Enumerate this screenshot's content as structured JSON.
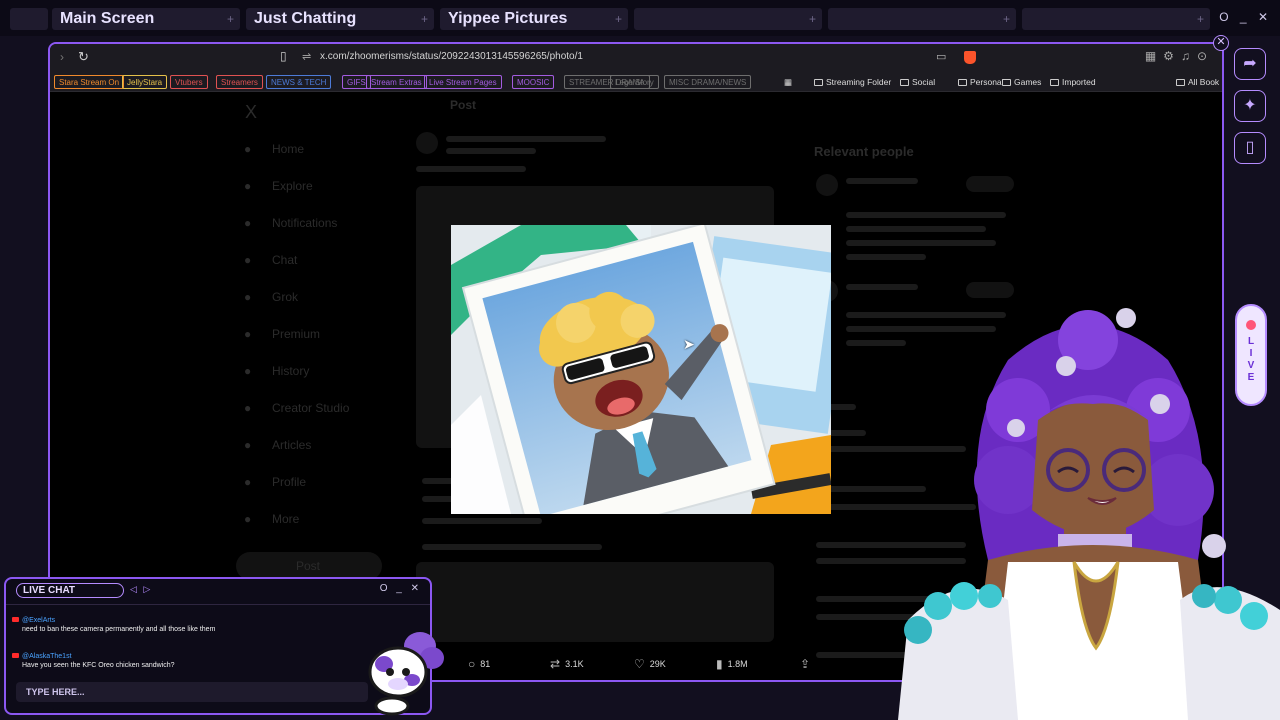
{
  "stream_tabs": [
    {
      "label": "Main Screen"
    },
    {
      "label": "Just Chatting"
    },
    {
      "label": "Yippee Pictures"
    },
    {
      "label": ""
    },
    {
      "label": ""
    },
    {
      "label": ""
    }
  ],
  "stream_window_controls": "O _ ✕",
  "browser": {
    "url": "x.com/zhoomerisms/status/2092243013145596265/photo/1",
    "bookmark_chips": [
      {
        "label": "Stara Stream On",
        "color": "#f08a2c"
      },
      {
        "label": "JellyStara",
        "color": "#e5c14a"
      },
      {
        "label": "Vtubers",
        "color": "#e05252"
      },
      {
        "label": "Streamers",
        "color": "#e05252"
      },
      {
        "label": "NEWS & TECH",
        "color": "#4d7bd8"
      },
      {
        "label": "GIFS",
        "color": "#a35ce0"
      },
      {
        "label": "Stream Extras",
        "color": "#a35ce0"
      },
      {
        "label": "Live Stream Pages",
        "color": "#a35ce0"
      },
      {
        "label": "MOOSIC",
        "color": "#a35ce0"
      },
      {
        "label": "STREAMER DRAMA",
        "color": "#6e6e6e"
      },
      {
        "label": "Lego Story",
        "color": "#6e6e6e"
      },
      {
        "label": "MISC DRAMA/NEWS",
        "color": "#6e6e6e"
      }
    ],
    "bookmark_folders": [
      "Streaming Folder",
      "Social",
      "Personal",
      "Games",
      "Imported",
      "All Book"
    ]
  },
  "x_page": {
    "nav": [
      "Home",
      "Explore",
      "Notifications",
      "Chat",
      "Grok",
      "Premium",
      "History",
      "Creator Studio",
      "Articles",
      "Profile",
      "More"
    ],
    "post_button": "Post",
    "post_header": "Post",
    "relevant_people": "Relevant people",
    "engagement": {
      "replies": "81",
      "reposts": "3.1K",
      "likes": "29K",
      "views": "1.8M"
    }
  },
  "chat": {
    "title": "LIVE CHAT",
    "controls": "O _ ✕",
    "messages": [
      {
        "user": "@ExelArts",
        "text": "need to ban these camera permanently and all those like them"
      },
      {
        "user": "@AlaskaThe1st",
        "text": "Have you seen the KFC Oreo chicken sandwich?"
      }
    ],
    "input_placeholder": "TYPE HERE..."
  },
  "live_badge": "LIVE",
  "colors": {
    "accent": "#8c58f2",
    "youtube": "#ff2b2b",
    "live_dot": "#ff5577"
  }
}
